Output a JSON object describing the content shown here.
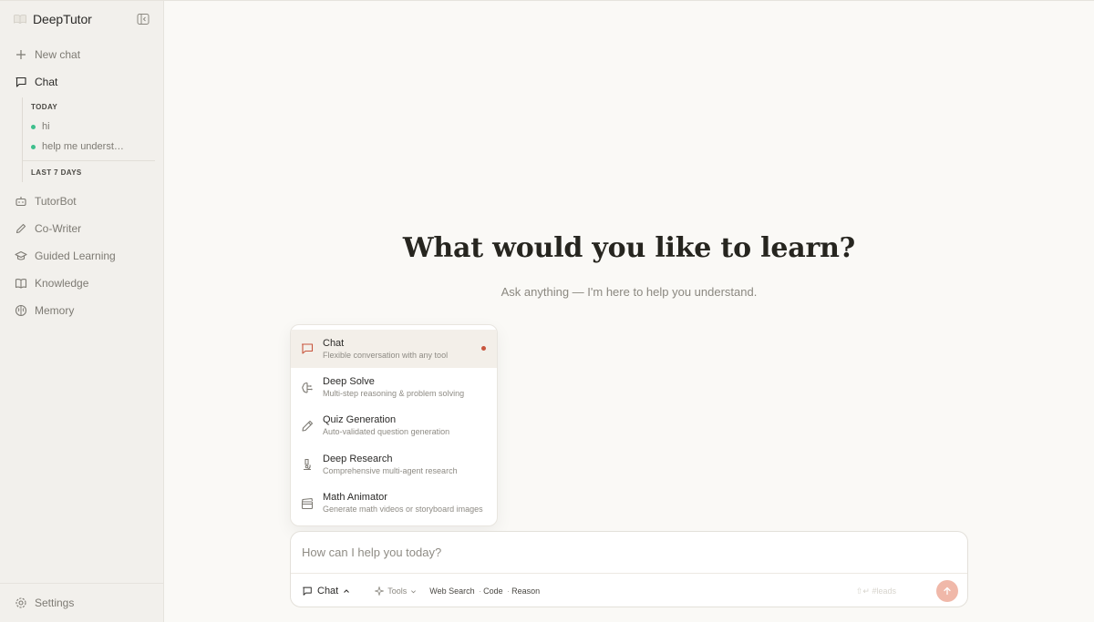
{
  "app": {
    "name": "DeepTutor"
  },
  "sidebar": {
    "new_chat": "New chat",
    "chat": "Chat",
    "history": {
      "today_label": "TODAY",
      "today_items": [
        "hi",
        "help me understand"
      ],
      "last7_label": "LAST 7 DAYS"
    },
    "items": [
      {
        "label": "TutorBot",
        "icon": "robot-icon"
      },
      {
        "label": "Co-Writer",
        "icon": "pen-icon"
      },
      {
        "label": "Guided Learning",
        "icon": "graduation-cap-icon"
      },
      {
        "label": "Knowledge",
        "icon": "book-icon"
      },
      {
        "label": "Memory",
        "icon": "brain-icon"
      }
    ],
    "settings": "Settings"
  },
  "main": {
    "title": "What would you like to learn?",
    "subtitle": "Ask anything — I'm here to help you understand."
  },
  "mode_menu": {
    "selected": "Chat",
    "items": [
      {
        "name": "Chat",
        "description": "Flexible conversation with any tool",
        "icon": "chat-bubble-icon"
      },
      {
        "name": "Deep Solve",
        "description": "Multi-step reasoning & problem solving",
        "icon": "brain-circuit-icon"
      },
      {
        "name": "Quiz Generation",
        "description": "Auto-validated question generation",
        "icon": "pencil-icon"
      },
      {
        "name": "Deep Research",
        "description": "Comprehensive multi-agent research",
        "icon": "microscope-icon"
      },
      {
        "name": "Math Animator",
        "description": "Generate math videos or storyboard images",
        "icon": "clapperboard-icon"
      }
    ]
  },
  "composer": {
    "placeholder": "How can I help you today?",
    "mode_label": "Chat",
    "tools_label": "Tools",
    "tools": [
      "Web Search",
      "Code",
      "Reason"
    ],
    "shortcut_hint": "⇧↵ #leads"
  },
  "colors": {
    "accent": "#c8553d",
    "send_button": "#f0b8a9",
    "history_dot": "#3fbf8c",
    "sidebar_bg": "#f2f0ec",
    "main_bg": "#faf9f6"
  }
}
